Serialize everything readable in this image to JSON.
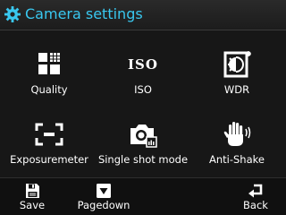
{
  "header": {
    "title": "Camera settings",
    "icon": "gear-icon",
    "title_color": "#39c8f0"
  },
  "grid": {
    "items": [
      {
        "label": "Quality",
        "icon": "quality-icon"
      },
      {
        "label": "ISO",
        "icon": "iso-icon",
        "icon_text": "ISO"
      },
      {
        "label": "WDR",
        "icon": "wdr-icon"
      },
      {
        "label": "Exposuremeter",
        "icon": "exposuremeter-icon"
      },
      {
        "label": "Single shot mode",
        "icon": "single-shot-icon"
      },
      {
        "label": "Anti-Shake",
        "icon": "anti-shake-icon"
      }
    ]
  },
  "softkeys": {
    "left": {
      "label": "Save",
      "icon": "floppy-disk-icon"
    },
    "center": {
      "label": "Pagedown",
      "icon": "page-down-icon"
    },
    "right": {
      "label": "Back",
      "icon": "back-arrow-icon"
    }
  }
}
